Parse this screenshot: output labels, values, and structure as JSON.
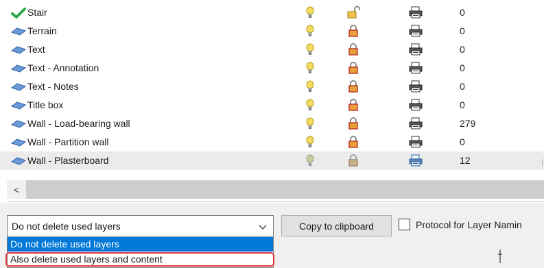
{
  "layers": [
    {
      "status": "checkmark-icon",
      "name": "Stair",
      "visible": true,
      "locked": false,
      "printable": true,
      "count": "0"
    },
    {
      "status": "layer-icon",
      "name": "Terrain",
      "visible": true,
      "locked": true,
      "printable": true,
      "count": "0"
    },
    {
      "status": "layer-icon",
      "name": "Text",
      "visible": true,
      "locked": true,
      "printable": true,
      "count": "0"
    },
    {
      "status": "layer-icon",
      "name": "Text - Annotation",
      "visible": true,
      "locked": true,
      "printable": true,
      "count": "0"
    },
    {
      "status": "layer-icon",
      "name": "Text - Notes",
      "visible": true,
      "locked": true,
      "printable": true,
      "count": "0"
    },
    {
      "status": "layer-icon",
      "name": "Title box",
      "visible": true,
      "locked": true,
      "printable": true,
      "count": "0"
    },
    {
      "status": "layer-icon",
      "name": "Wall - Load-bearing wall",
      "visible": true,
      "locked": true,
      "printable": true,
      "count": "279"
    },
    {
      "status": "layer-icon",
      "name": "Wall - Partition wall",
      "visible": true,
      "locked": true,
      "printable": true,
      "count": "0"
    },
    {
      "status": "layer-icon",
      "name": "Wall - Plasterboard",
      "visible": true,
      "locked": true,
      "printable": true,
      "count": "12",
      "selected": true
    }
  ],
  "scrollbar": {
    "left_arrow": "<"
  },
  "delete_option": {
    "selected": "Do not delete used layers",
    "options": [
      "Do not delete used layers",
      "Also delete used layers and content"
    ]
  },
  "copy_button_label": "Copy to clipboard",
  "protocol_checkbox": {
    "label": "Protocol for Layer Namin",
    "checked": false
  },
  "colors": {
    "selection_blue": "#0078d7",
    "highlight_red": "#e0333e",
    "check_green": "#2fa84f",
    "layer_blue": "#6a9bd8",
    "lock_orange": "#e8a13a",
    "bulb_yellow": "#f2dc5d"
  }
}
